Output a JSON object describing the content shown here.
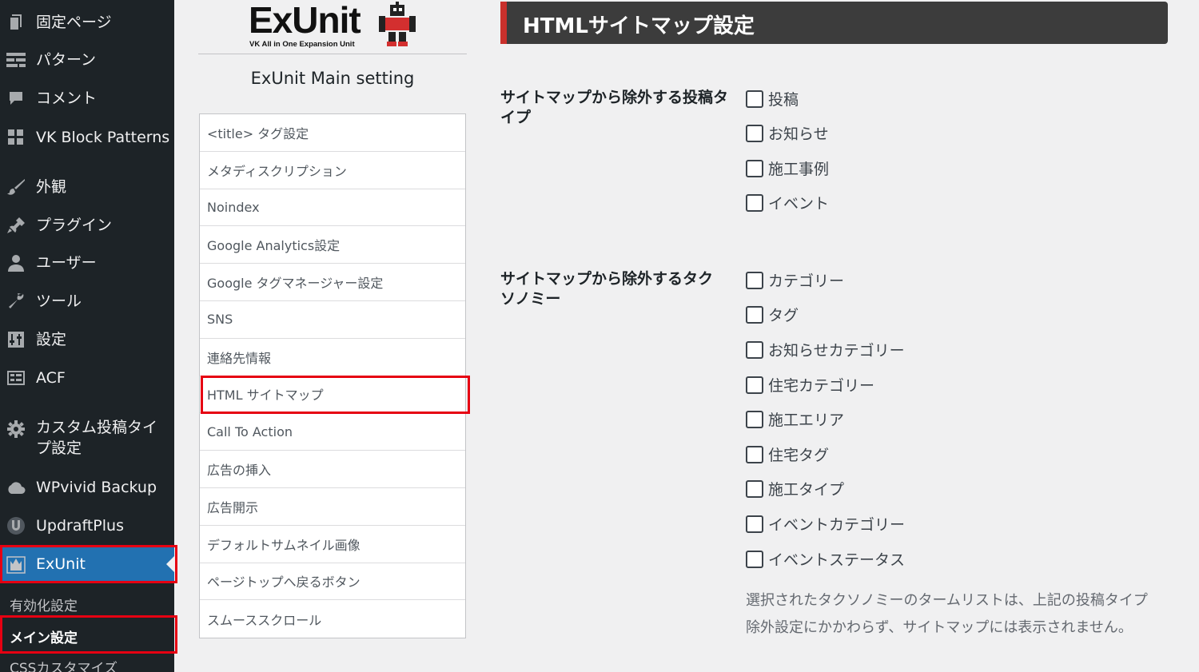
{
  "sidebar": {
    "items": [
      {
        "label": "固定ページ",
        "icon": "page-icon"
      },
      {
        "label": "パターン",
        "icon": "pattern-icon"
      },
      {
        "label": "コメント",
        "icon": "comment-icon"
      },
      {
        "label": "VK Block Patterns",
        "icon": "grid-icon"
      },
      {
        "label": "外観",
        "icon": "brush-icon"
      },
      {
        "label": "プラグイン",
        "icon": "plugin-icon"
      },
      {
        "label": "ユーザー",
        "icon": "user-icon"
      },
      {
        "label": "ツール",
        "icon": "wrench-icon"
      },
      {
        "label": "設定",
        "icon": "settings-icon"
      },
      {
        "label": "ACF",
        "icon": "acf-icon"
      },
      {
        "label": "カスタム投稿タイプ設定",
        "icon": "gear-icon"
      },
      {
        "label": "WPvivid Backup",
        "icon": "cloud-icon"
      },
      {
        "label": "UpdraftPlus",
        "icon": "updraft-icon"
      },
      {
        "label": "ExUnit",
        "icon": "exunit-icon"
      }
    ],
    "submenu": [
      "有効化設定",
      "メイン設定",
      "CSSカスタマイズ"
    ]
  },
  "logo": {
    "text": "ExUnit",
    "subtext": "VK All in One Expansion Unit"
  },
  "main_title": "ExUnit Main setting",
  "nav": [
    "<title> タグ設定",
    "メタディスクリプション",
    "Noindex",
    "Google Analytics設定",
    "Google タグマネージャー設定",
    "SNS",
    "連絡先情報",
    "HTML サイトマップ",
    "Call To Action",
    "広告の挿入",
    "広告開示",
    "デフォルトサムネイル画像",
    "ページトップへ戻るボタン",
    "スムーススクロール"
  ],
  "section_title": "HTMLサイトマップ設定",
  "post_types": {
    "label": "サイトマップから除外する投稿タイプ",
    "options": [
      "投稿",
      "お知らせ",
      "施工事例",
      "イベント"
    ]
  },
  "taxonomies": {
    "label": "サイトマップから除外するタクソノミー",
    "options": [
      "カテゴリー",
      "タグ",
      "お知らせカテゴリー",
      "住宅カテゴリー",
      "施工エリア",
      "住宅タグ",
      "施工タイプ",
      "イベントカテゴリー",
      "イベントステータス"
    ]
  },
  "note": "選択されたタクソノミーのタームリストは、上記の投稿タイプ除外設定にかかわらず、サイトマップには表示されません。",
  "colors": {
    "sidebar_bg": "#1d2327",
    "active_bg": "#2271b1",
    "highlight": "#e60012",
    "header_bg": "#3c3c3c",
    "header_accent": "#c9302c"
  }
}
